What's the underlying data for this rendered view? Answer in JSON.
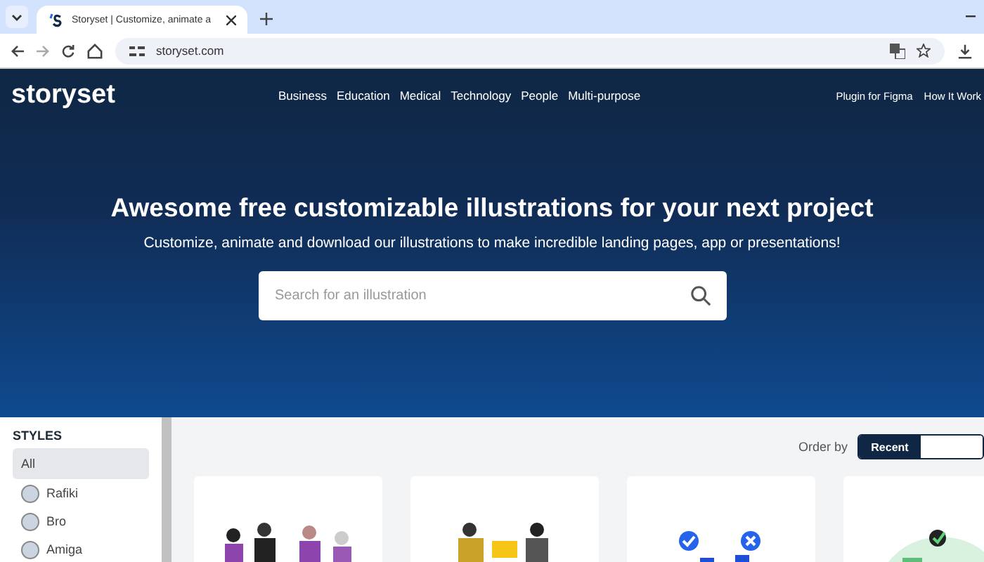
{
  "browser": {
    "tab_title": "Storyset | Customize, animate a",
    "url": "storyset.com"
  },
  "site": {
    "logo": "storyset",
    "nav": [
      "Business",
      "Education",
      "Medical",
      "Technology",
      "People",
      "Multi-purpose"
    ],
    "nav_right": [
      "Plugin for Figma",
      "How It Work"
    ]
  },
  "hero": {
    "title": "Awesome free customizable illustrations for your next project",
    "subtitle": "Customize, animate and download our illustrations to make incredible landing pages, app or presentations!",
    "search": {
      "placeholder": "Search for an illustration"
    }
  },
  "sidebar": {
    "heading": "STYLES",
    "items": [
      {
        "label": "All",
        "selected": true
      },
      {
        "label": "Rafiki",
        "selected": false
      },
      {
        "label": "Bro",
        "selected": false
      },
      {
        "label": "Amiga",
        "selected": false
      }
    ]
  },
  "order": {
    "label": "Order by",
    "options": [
      {
        "label": "Recent",
        "selected": true
      },
      {
        "selected": false
      }
    ]
  },
  "cards": [
    {
      "kind": "people"
    },
    {
      "kind": "gift"
    },
    {
      "kind": "vote"
    },
    {
      "kind": "eco"
    }
  ]
}
